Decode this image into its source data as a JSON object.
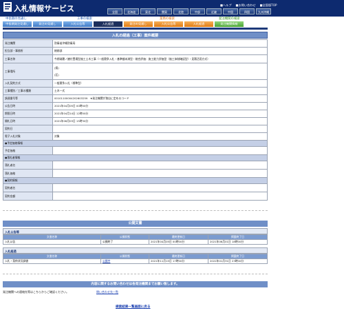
{
  "header": {
    "site_title": "入札情報サービス",
    "links": [
      "■ヘルプ",
      "■お問い合わせ",
      "■全国版TOP"
    ],
    "regions": [
      "全国",
      "北海道",
      "東北",
      "関東",
      "北陸",
      "中部",
      "近畿",
      "中国",
      "四国",
      "九州沖縄"
    ]
  },
  "categories": [
    "中長期の見通し",
    "工事の検索",
    "業務の検索",
    "発注機関の検索"
  ],
  "tabs": [
    "中長期発注見通し",
    "発注の見通し",
    "入札公告等",
    "入札経過",
    "発注の見通し",
    "入札公告等",
    "入札経過",
    "発注機関情報"
  ],
  "main_title": "入札の経過（工事）案件概要",
  "details": {
    "org_label": "発注機関",
    "org_value": "防衛省沖縄防衛局",
    "office_label": "担当部・事務所",
    "office_value": "総務部",
    "name_label": "工事名称",
    "name_value": "今期瑞穂ノ繕付置場型施工土木工事（一般競争入札・基準額未満型・総合評価：施工能力評価型（施工体制確認型）・見積活用方式）",
    "place_label": "工事場所",
    "place_value_1": "(県)",
    "place_value_2": "(区)",
    "method_label": "入札契約方式",
    "method_value": "一般競争入札（標準型）",
    "type_label": "工事種別／工事の種類",
    "type_value": "土木一式",
    "id_label": "調達番号等",
    "id_value": "00101100004202603259",
    "id_note": "★発注機関が独自に定めるコード",
    "pub_label": "公告日時",
    "pub_value": "2021年04月05日 00時00分",
    "dl_label": "期限日時",
    "dl_value": "2021年04月14日 12時00分",
    "open_label": "開札日時",
    "open_value": "2021年06月03日 15時30分",
    "contract_label": "契約日",
    "contract_value": "",
    "einyu_label": "電子入札対象",
    "einyu_value": "対象",
    "price_section": "●予定価格情報",
    "price_label": "予定価格",
    "price_value": "",
    "winner_section": "●落札者情報",
    "winner_name_label": "落札者名",
    "winner_name_value": "",
    "winner_price_label": "落札価格",
    "winner_price_value": "",
    "contract_section": "●契約情報",
    "party_label": "契約者名",
    "party_value": "",
    "amount_label": "契約金額",
    "amount_value": ""
  },
  "documents": {
    "title": "公開文書",
    "sections": [
      {
        "label": "入札公告等",
        "headers": [
          "文書名称",
          "公開状態",
          "最終更新日",
          "掲載終了日"
        ],
        "rows": [
          [
            "入札公告",
            "公開終了",
            "2021年04月05日 00時00分",
            "2021年06月01日 18時00分"
          ]
        ]
      },
      {
        "label": "入札経過",
        "headers": [
          "文書名称",
          "公開状態",
          "最終更新日",
          "掲載終了日"
        ],
        "rows": [
          [
            "入札・契約状況調書",
            "公開中",
            "2021年11月15日 17時00分",
            "2022年01月31日 23時00分"
          ]
        ]
      }
    ]
  },
  "inquiry": {
    "title": "内容に関するお問い合わせは各発注機関までお願い致します。",
    "text": "発注機関への連絡先等はこちらからご確認ください。",
    "link": "問い合わせ先一覧"
  },
  "back_link": "検索結果一覧画面に戻る"
}
